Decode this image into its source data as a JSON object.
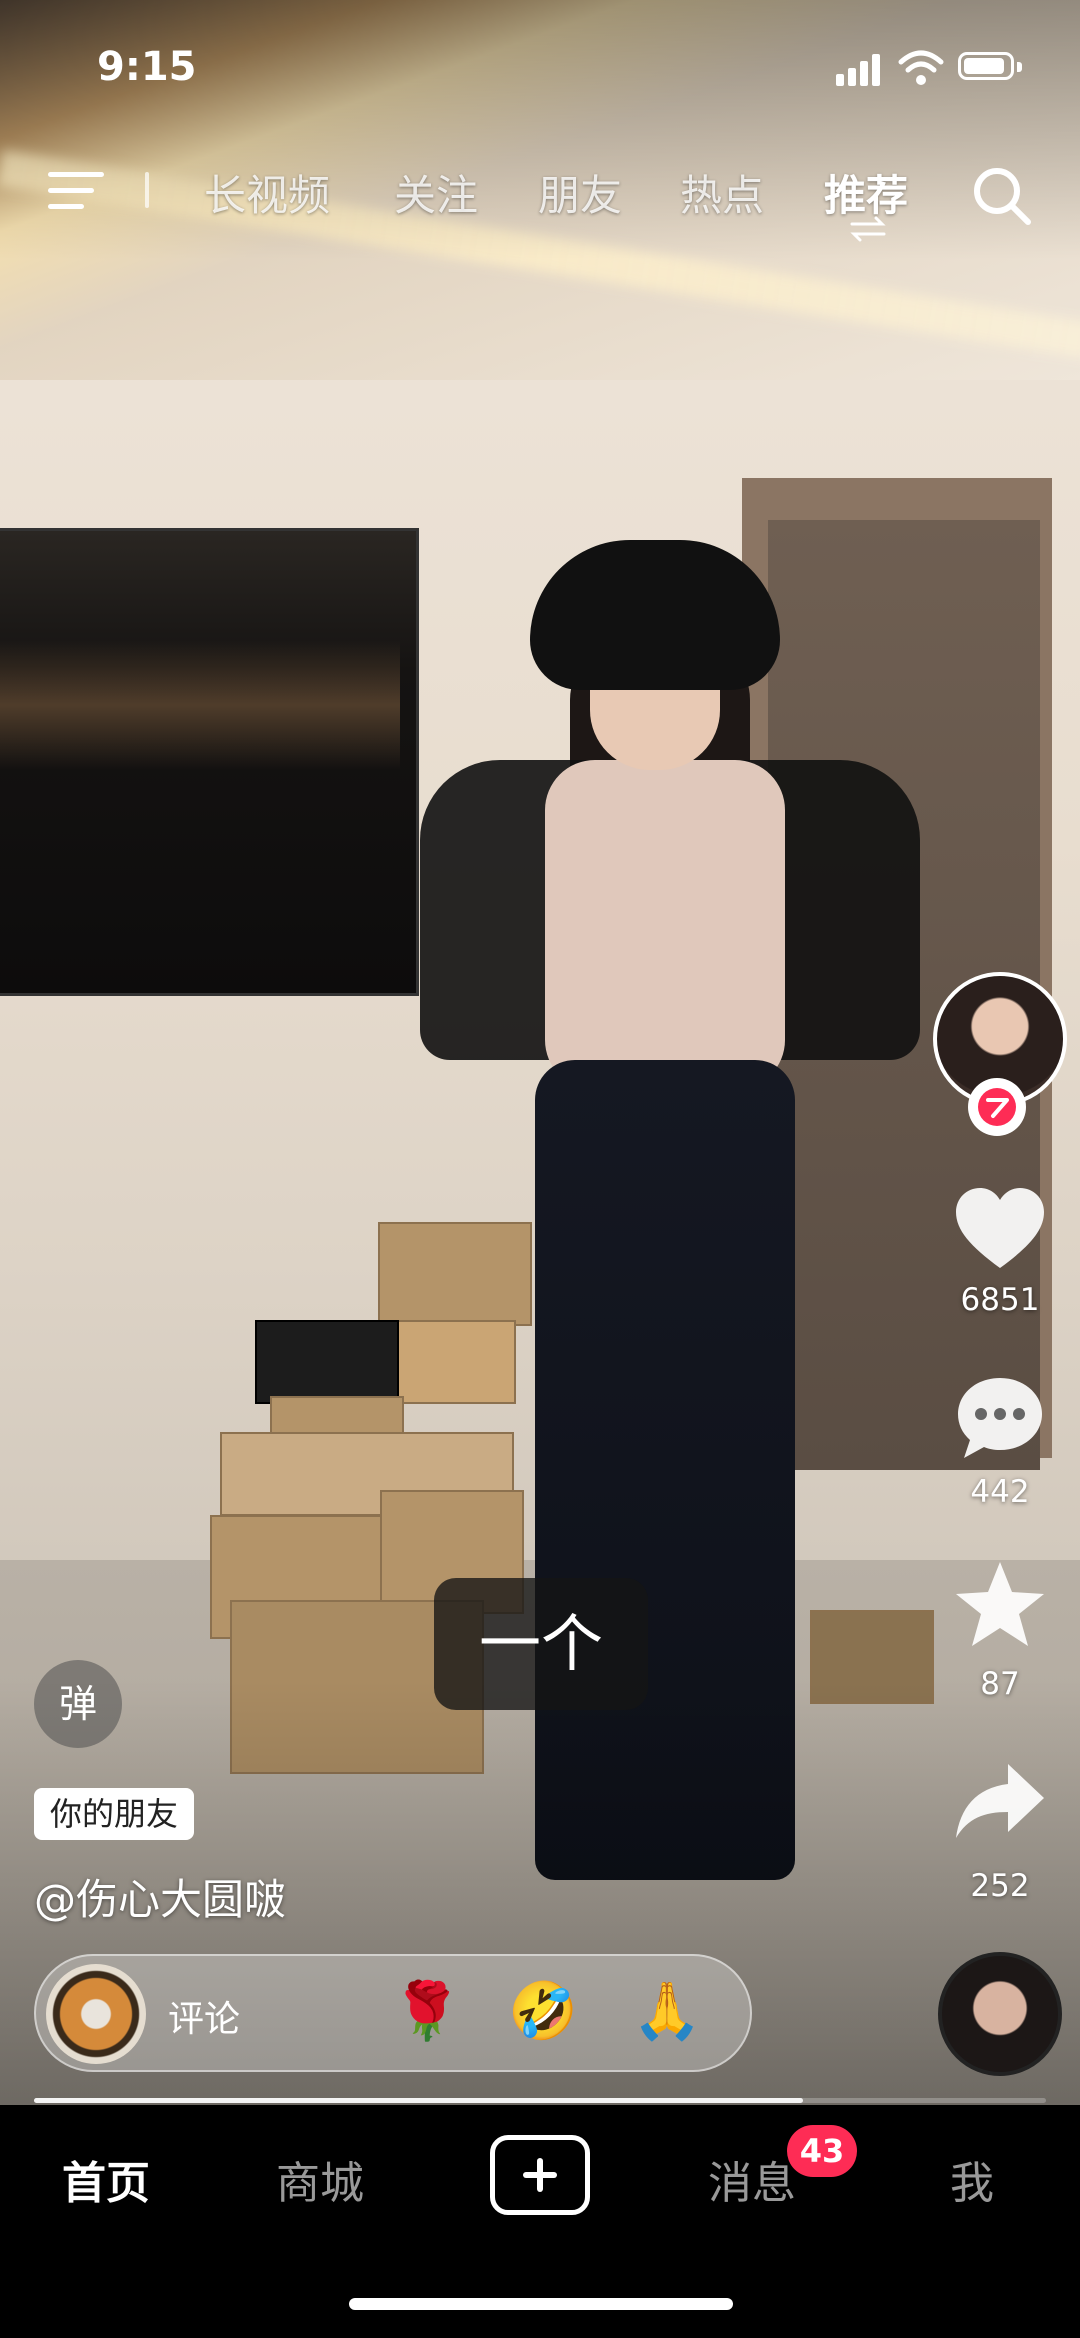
{
  "status_bar": {
    "time": "9:15"
  },
  "top_nav": {
    "tabs": [
      {
        "label": "长视频"
      },
      {
        "label": "关注"
      },
      {
        "label": "朋友"
      },
      {
        "label": "热点"
      },
      {
        "label": "推荐"
      }
    ],
    "active_tab": "推荐"
  },
  "video": {
    "subtitle": "一个",
    "danmaku_label": "弹",
    "friend_tag": "你的朋友",
    "author": "@伤心大圆啵",
    "progress_fraction": 0.76
  },
  "actions": {
    "likes": "6851",
    "comments": "442",
    "favorites": "87",
    "shares": "252"
  },
  "comment_bar": {
    "placeholder": "评论",
    "emojis": [
      "🌹",
      "🤣",
      "🙏"
    ]
  },
  "bottom_nav": {
    "items": [
      {
        "label": "首页"
      },
      {
        "label": "商城"
      },
      {
        "label": "消息"
      },
      {
        "label": "我"
      }
    ],
    "messages_badge": "43"
  },
  "colors": {
    "accent": "#fe2c55",
    "background": "#000000"
  },
  "icons": [
    "menu-icon",
    "search-icon",
    "refresh-icon",
    "heart-icon",
    "comment-icon",
    "star-icon",
    "share-icon",
    "plus-icon",
    "follow-icon"
  ]
}
